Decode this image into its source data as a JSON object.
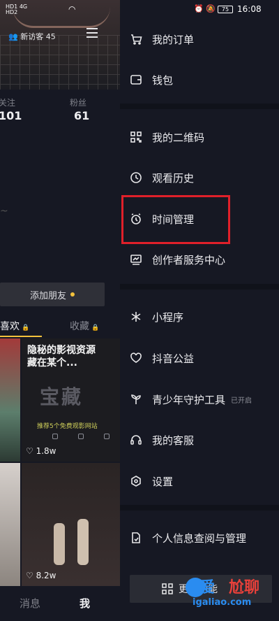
{
  "left_page": {
    "status": {
      "sim1": "HD1",
      "sim2": "HD2",
      "signal": "4G"
    },
    "visitor_label": "新访客 45",
    "stats": [
      {
        "label": "关注",
        "value": "101"
      },
      {
        "label": "粉丝",
        "value": "61"
      }
    ],
    "add_friend": "添加朋友",
    "tabs": {
      "likes": "喜欢",
      "favorites": "收藏"
    },
    "tile_texts": {
      "title_line1": "隐秘的影视资源",
      "title_line2": "藏在某个...",
      "big": "宝藏",
      "subtitle": "推荐5个免费观影网站"
    },
    "like_counts": [
      "1.8w",
      "8.2w"
    ],
    "bottom_nav": {
      "messages": "消息",
      "me": "我"
    }
  },
  "drawer": {
    "status": {
      "battery": "75",
      "time": "16:08"
    },
    "items": [
      {
        "label": "我的订单",
        "icon": "cart-icon"
      },
      {
        "label": "钱包",
        "icon": "wallet-icon"
      },
      {
        "label": "我的二维码",
        "icon": "qrcode-icon"
      },
      {
        "label": "观看历史",
        "icon": "clock-icon"
      },
      {
        "label": "时间管理",
        "icon": "alarm-clock-icon"
      },
      {
        "label": "创作者服务中心",
        "icon": "chart-icon"
      },
      {
        "label": "小程序",
        "icon": "asterisk-icon"
      },
      {
        "label": "抖音公益",
        "icon": "heart-icon"
      },
      {
        "label": "青少年守护工具",
        "icon": "sprout-icon",
        "badge": "已开启"
      },
      {
        "label": "我的客服",
        "icon": "headset-icon"
      },
      {
        "label": "设置",
        "icon": "settings-hex-icon"
      },
      {
        "label": "个人信息查阅与管理",
        "icon": "doc-icon"
      }
    ],
    "more_features": "更多功能"
  },
  "highlight_color": "#e0202a",
  "watermark": {
    "line1a": "爱",
    "line1b": "尬聊",
    "line2": "igaliao.com"
  }
}
